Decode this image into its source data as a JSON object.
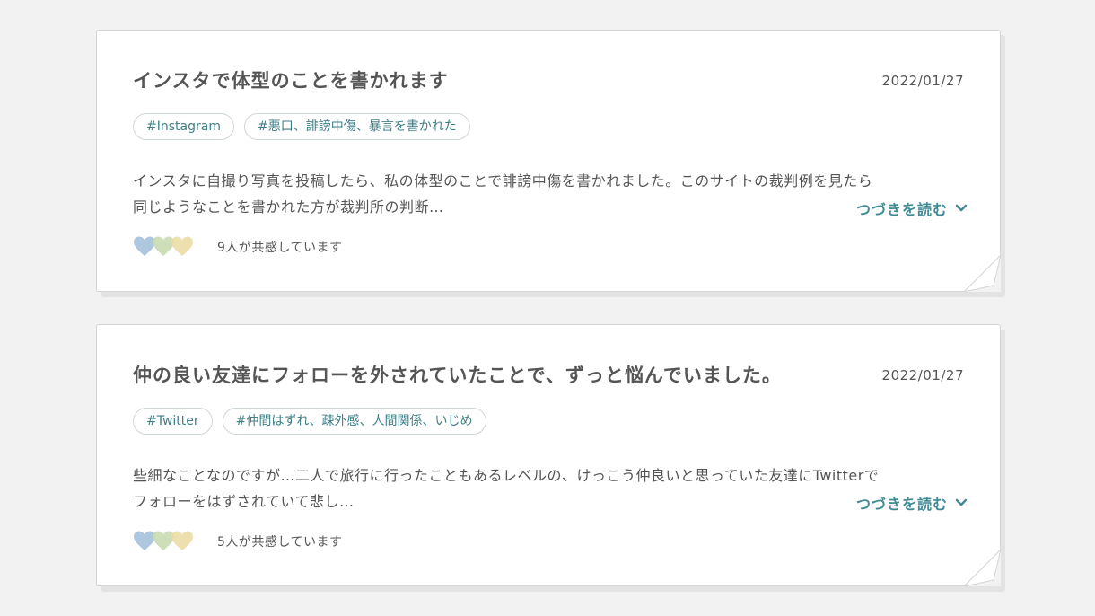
{
  "colors": {
    "background": "#f2f2f2",
    "card": "#ffffff",
    "accent": "#3f8a93",
    "tag_text": "#3f7f87",
    "heart_blue": "#a9c4dc",
    "heart_green": "#c6dcb0",
    "heart_yellow": "#ecdca6"
  },
  "icons": {
    "hearts": [
      "heart-blue-icon",
      "heart-green-icon",
      "heart-yellow-icon"
    ],
    "readmore": "chevron-down-icon",
    "corner": "page-curl-icon"
  },
  "posts": [
    {
      "title": "インスタで体型のことを書かれます",
      "date": "2022/01/27",
      "tags": [
        "#Instagram",
        "#悪口、誹謗中傷、暴言を書かれた"
      ],
      "excerpt_line1": "インスタに自撮り写真を投稿したら、私の体型のことで誹謗中傷を書かれました。このサイトの裁判例を見たら",
      "excerpt_line2": "同じようなことを書かれた方が裁判所の判断…",
      "readmore": "つづきを読む",
      "empathy": "9人が共感しています"
    },
    {
      "title": "仲の良い友達にフォローを外されていたことで、ずっと悩んでいました。",
      "date": "2022/01/27",
      "tags": [
        "#Twitter",
        "#仲間はずれ、疎外感、人間関係、いじめ"
      ],
      "excerpt_line1": "些細なことなのですが…二人で旅行に行ったこともあるレベルの、けっこう仲良いと思っていた友達にTwitterで",
      "excerpt_line2": "フォローをはずされていて悲し…",
      "readmore": "つづきを読む",
      "empathy": "5人が共感しています"
    }
  ]
}
